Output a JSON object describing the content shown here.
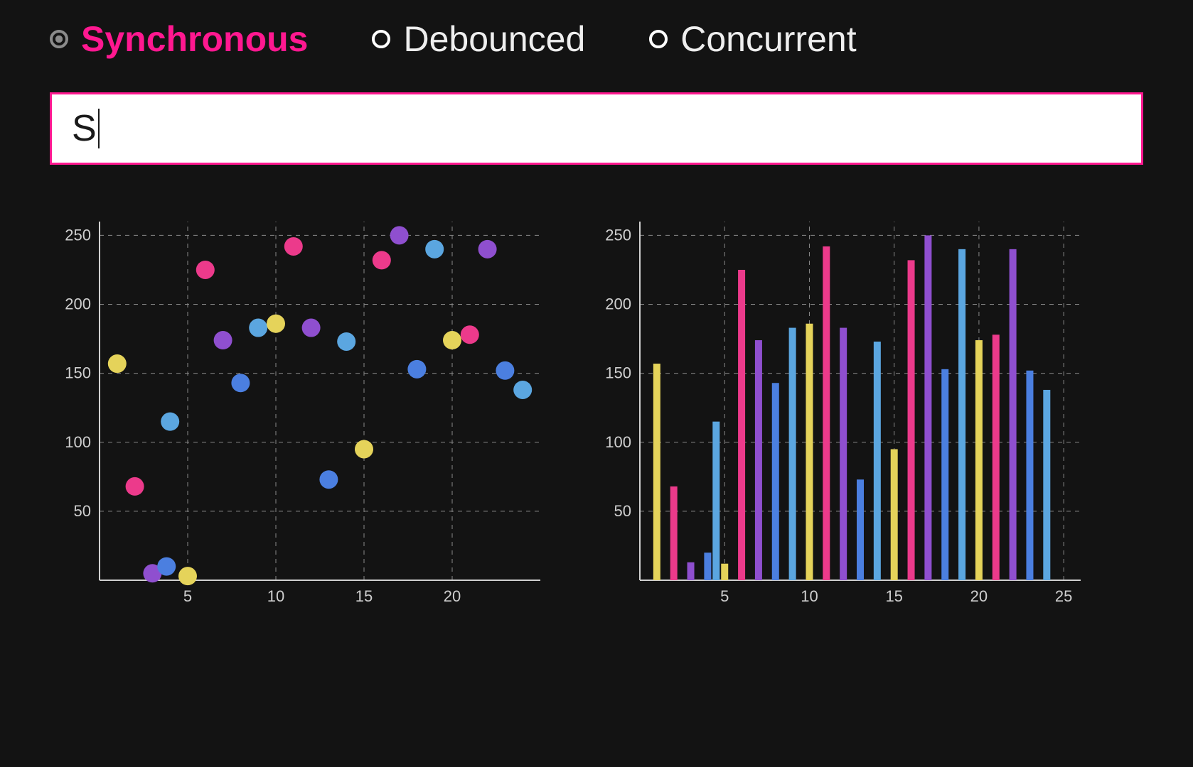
{
  "modes": {
    "items": [
      {
        "label": "Synchronous",
        "selected": true
      },
      {
        "label": "Debounced",
        "selected": false
      },
      {
        "label": "Concurrent",
        "selected": false
      }
    ]
  },
  "input": {
    "value": "S"
  },
  "colors": {
    "pink": "#ec3a8b",
    "purple": "#8f4fcf",
    "blue": "#4b7fe0",
    "lightblue": "#5ba6e0",
    "yellow": "#e5d35a"
  },
  "chart_data": [
    {
      "type": "scatter",
      "xlim": [
        0,
        25
      ],
      "ylim": [
        0,
        260
      ],
      "xticks": [
        5,
        10,
        15,
        20
      ],
      "yticks": [
        50,
        100,
        150,
        200,
        250
      ],
      "points": [
        {
          "x": 1,
          "y": 157,
          "c": "yellow"
        },
        {
          "x": 2,
          "y": 68,
          "c": "pink"
        },
        {
          "x": 3,
          "y": 5,
          "c": "purple"
        },
        {
          "x": 3.8,
          "y": 10,
          "c": "blue"
        },
        {
          "x": 4,
          "y": 115,
          "c": "lightblue"
        },
        {
          "x": 5,
          "y": 3,
          "c": "yellow"
        },
        {
          "x": 6,
          "y": 225,
          "c": "pink"
        },
        {
          "x": 7,
          "y": 174,
          "c": "purple"
        },
        {
          "x": 8,
          "y": 143,
          "c": "blue"
        },
        {
          "x": 9,
          "y": 183,
          "c": "lightblue"
        },
        {
          "x": 10,
          "y": 186,
          "c": "yellow"
        },
        {
          "x": 11,
          "y": 242,
          "c": "pink"
        },
        {
          "x": 12,
          "y": 183,
          "c": "purple"
        },
        {
          "x": 13,
          "y": 73,
          "c": "blue"
        },
        {
          "x": 14,
          "y": 173,
          "c": "lightblue"
        },
        {
          "x": 15,
          "y": 95,
          "c": "yellow"
        },
        {
          "x": 16,
          "y": 232,
          "c": "pink"
        },
        {
          "x": 17,
          "y": 250,
          "c": "purple"
        },
        {
          "x": 18,
          "y": 153,
          "c": "blue"
        },
        {
          "x": 19,
          "y": 240,
          "c": "lightblue"
        },
        {
          "x": 20,
          "y": 174,
          "c": "yellow"
        },
        {
          "x": 21,
          "y": 178,
          "c": "pink"
        },
        {
          "x": 22,
          "y": 240,
          "c": "purple"
        },
        {
          "x": 23,
          "y": 152,
          "c": "blue"
        },
        {
          "x": 24,
          "y": 138,
          "c": "lightblue"
        }
      ]
    },
    {
      "type": "bar",
      "xlim": [
        0,
        26
      ],
      "ylim": [
        0,
        260
      ],
      "xticks": [
        5,
        10,
        15,
        20,
        25
      ],
      "yticks": [
        50,
        100,
        150,
        200,
        250
      ],
      "series": [
        {
          "x": 1,
          "y": 157,
          "c": "yellow"
        },
        {
          "x": 2,
          "y": 68,
          "c": "pink"
        },
        {
          "x": 3,
          "y": 13,
          "c": "purple"
        },
        {
          "x": 4,
          "y": 20,
          "c": "blue"
        },
        {
          "x": 4.5,
          "y": 115,
          "c": "lightblue"
        },
        {
          "x": 5,
          "y": 12,
          "c": "yellow"
        },
        {
          "x": 6,
          "y": 225,
          "c": "pink"
        },
        {
          "x": 7,
          "y": 174,
          "c": "purple"
        },
        {
          "x": 8,
          "y": 143,
          "c": "blue"
        },
        {
          "x": 9,
          "y": 183,
          "c": "lightblue"
        },
        {
          "x": 10,
          "y": 186,
          "c": "yellow"
        },
        {
          "x": 11,
          "y": 242,
          "c": "pink"
        },
        {
          "x": 12,
          "y": 183,
          "c": "purple"
        },
        {
          "x": 13,
          "y": 73,
          "c": "blue"
        },
        {
          "x": 14,
          "y": 173,
          "c": "lightblue"
        },
        {
          "x": 15,
          "y": 95,
          "c": "yellow"
        },
        {
          "x": 16,
          "y": 232,
          "c": "pink"
        },
        {
          "x": 17,
          "y": 250,
          "c": "purple"
        },
        {
          "x": 18,
          "y": 153,
          "c": "blue"
        },
        {
          "x": 19,
          "y": 240,
          "c": "lightblue"
        },
        {
          "x": 20,
          "y": 174,
          "c": "yellow"
        },
        {
          "x": 21,
          "y": 178,
          "c": "pink"
        },
        {
          "x": 22,
          "y": 240,
          "c": "purple"
        },
        {
          "x": 23,
          "y": 152,
          "c": "blue"
        },
        {
          "x": 24,
          "y": 138,
          "c": "lightblue"
        }
      ]
    }
  ]
}
